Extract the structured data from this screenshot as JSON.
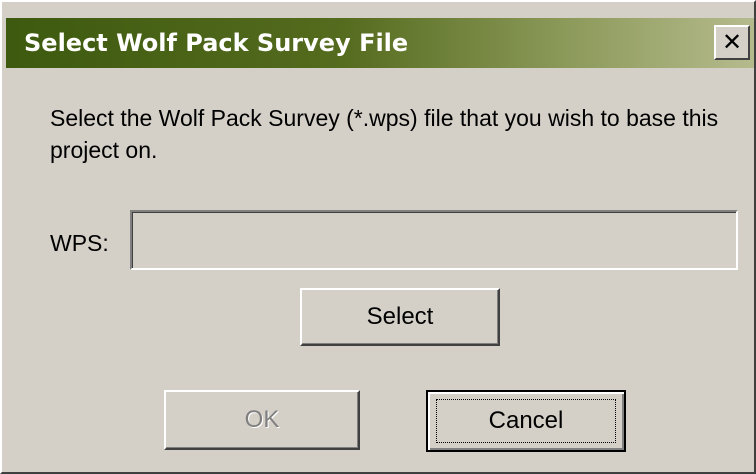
{
  "dialog": {
    "title": "Select Wolf Pack Survey File",
    "close_glyph": "✕",
    "prompt": "Select the Wolf Pack Survey (*.wps) file that you wish to base this project on.",
    "wps_label": "WPS:",
    "wps_value": "",
    "select_label": "Select",
    "ok_label": "OK",
    "cancel_label": "Cancel"
  },
  "colors": {
    "titlebar_start": "#3d5a0f",
    "titlebar_end": "#b6bb8e",
    "face": "#d4d0c8",
    "disabled_text": "#808080"
  },
  "icons": {
    "close": "close-icon"
  }
}
